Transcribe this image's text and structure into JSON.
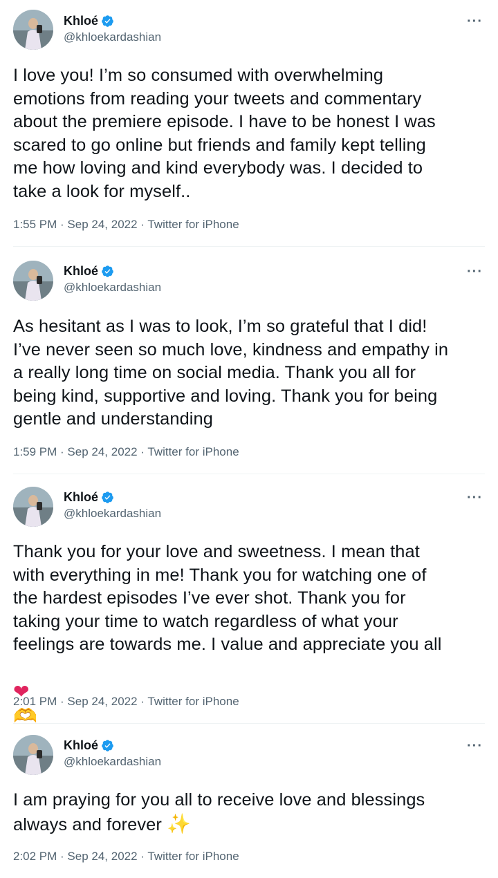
{
  "tweets": [
    {
      "name": "Khloé",
      "handle": "@khloekardashian",
      "text": "I love you! I’m so consumed with overwhelming\nemotions from reading your tweets and commentary\nabout the premiere episode. I have to be honest I was\nscared to go online but friends and family kept telling\nme how loving and kind everybody was. I decided to\ntake a look for myself..",
      "meta": "1:55 PM · Sep 24, 2022 · Twitter for iPhone"
    },
    {
      "name": "Khloé",
      "handle": "@khloekardashian",
      "text": "As hesitant as I was to look, I’m so grateful that I did!\nI’ve never seen so much love, kindness and empathy in\na really long time on social media. Thank you all for\nbeing kind, supportive and loving. Thank you for being\ngentle and understanding",
      "meta": "1:59 PM · Sep 24, 2022 · Twitter for iPhone"
    },
    {
      "name": "Khloé",
      "handle": "@khloekardashian",
      "text": "Thank you for your love and sweetness. I mean that\nwith everything in me! Thank you for watching one of\nthe hardest episodes I’ve ever shot. Thank you for\ntaking your time to watch regardless of what your\nfeelings are towards me. I value and appreciate you all",
      "emoji_heart": "❤",
      "emoji_hands": "🫶",
      "meta": "2:01 PM · Sep 24, 2022 · Twitter for iPhone"
    },
    {
      "name": "Khloé",
      "handle": "@khloekardashian",
      "text": "I am praying for you all to receive love and blessings\nalways and forever",
      "emoji_sparkles": "✨",
      "meta": "2:02 PM · Sep 24, 2022 · Twitter for iPhone"
    }
  ],
  "more_label": "···",
  "colors": {
    "verified": "#1d9bf0",
    "text": "#0f1419",
    "secondary": "#536471",
    "divider": "#eff3f4"
  }
}
